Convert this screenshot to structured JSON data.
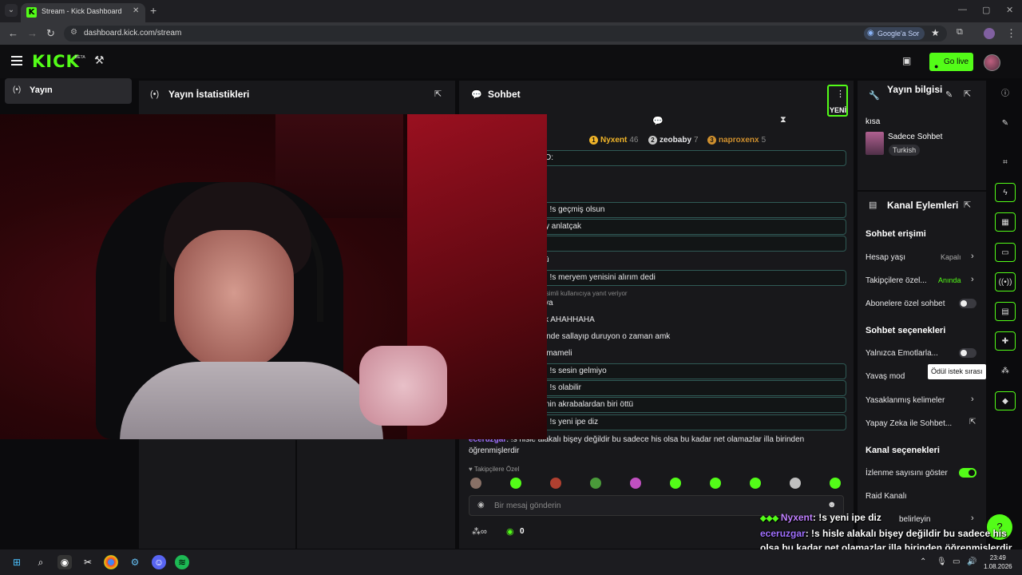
{
  "browser": {
    "tab_title": "Stream - Kick Dashboard",
    "url": "dashboard.kick.com/stream",
    "google_pill": "Google'a Sor"
  },
  "header": {
    "logo": "KICK",
    "logo_badge": "BETA",
    "go_live": "Go live"
  },
  "sidebar": {
    "items": [
      {
        "label": "Yayın"
      }
    ]
  },
  "stats_panel": {
    "title": "Yayın İstatistikleri"
  },
  "chat": {
    "title": "Sohbet",
    "menu_badge": "YENİ",
    "leaderboard": [
      {
        "rank": "1",
        "name": "Nyxent",
        "count": "46",
        "color": "#f0b429"
      },
      {
        "rank": "2",
        "name": "zeobaby",
        "count": "7",
        "color": "#c8c8c8"
      },
      {
        "rank": "3",
        "name": "naproxenx",
        "count": "5",
        "color": "#d0902e"
      }
    ],
    "messages": [
      {
        "text": "D:",
        "boxed": true
      },
      {
        "text": ":",
        "boxed": false
      },
      {
        "text": "",
        "boxed": false
      },
      {
        "text": ": !s geçmiş olsun",
        "boxed": true
      },
      {
        "text": "y anlatçak",
        "boxed": true
      },
      {
        "text": "",
        "boxed": true
      },
      {
        "text": "ü",
        "boxed": false
      },
      {
        "text": ": !s meryem yenisini alırım dedi",
        "boxed": true
      },
      {
        "text": "ya",
        "boxed": false
      },
      {
        "text": "k AHAHHAHA",
        "boxed": false
      },
      {
        "text": "inde sallayıp duruyon o zaman amk",
        "boxed": false
      },
      {
        "text": "imameli",
        "boxed": false
      },
      {
        "text": ": !s sesin gelmiyo",
        "boxed": true
      },
      {
        "text": ": !s olabilir",
        "boxed": true
      },
      {
        "text": "nin akrabalardan biri öttü",
        "boxed": true
      },
      {
        "text": ": !s yeni ipe diz",
        "boxed": true
      }
    ],
    "reply_hint": "isimli kullanıcıya yanıt veriyor",
    "last_message": {
      "user": "eceruzgar",
      "text": ": !s hisle alakalı bişey değildir bu sadece his olsa bu kadar net olamazlar illa birinden öğrenmişlerdir"
    },
    "followers_only": "Takipçilere Özel",
    "input_placeholder": "Bir mesaj gönderin",
    "footer_count": "0"
  },
  "stream_info": {
    "title": "Yayın bilgisi",
    "stream_title": "kısa",
    "category": "Sadece Sohbet",
    "language": "Turkish"
  },
  "channel_actions": {
    "title": "Kanal Eylemleri",
    "sections": {
      "access": "Sohbet erişimi",
      "options": "Sohbet seçenekleri",
      "channel": "Kanal seçenekleri"
    },
    "rows": {
      "account_age": {
        "label": "Hesap yaşı",
        "value": "Kapalı"
      },
      "followers": {
        "label": "Takipçilere özel...",
        "value": "Anında"
      },
      "subs_only": {
        "label": "Abonelere özel sohbet"
      },
      "emotes_only": {
        "label": "Yalnızca Emotlarla..."
      },
      "slow_mode": {
        "label": "Yavaş mod"
      },
      "banned_words": {
        "label": "Yasaklanmış kelimeler"
      },
      "ai_chat": {
        "label": "Yapay Zeka ile Sohbet..."
      },
      "show_viewers": {
        "label": "İzlenme sayısını göster"
      },
      "raid": {
        "label": "Raid Kanalı"
      },
      "set": {
        "label": "belirleyin"
      }
    },
    "toggles": {
      "subs_only": false,
      "emotes_only": false,
      "show_viewers": true
    }
  },
  "tooltip": "Ödül istek sırası",
  "overlay": {
    "line1_user": "Nyxent",
    "line1_text": ": !s yeni ipe diz",
    "line2_user": "eceruzgar",
    "line2_text": ": !s hisle alakalı bişey değildir bu sadece his olsa bu kadar net olamazlar illa birinden öğrenmişlerdir"
  },
  "taskbar": {
    "time": "23:49",
    "date": "1.08.2026"
  },
  "colors": {
    "accent": "#53fc18",
    "panel": "#18181b",
    "bg": "#0b0b0d"
  }
}
